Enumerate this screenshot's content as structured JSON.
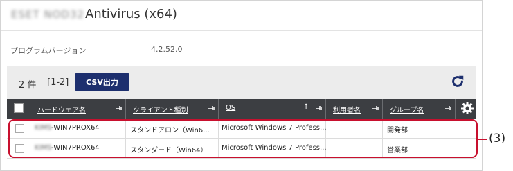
{
  "window": {
    "product_blurred": "ESET NOD32",
    "product_title": "Antivirus (x64)"
  },
  "info": {
    "version_label": "プログラムバージョン",
    "version_value": "4.2.52.0"
  },
  "toolbar": {
    "count": "2 件",
    "range": "[1-2]",
    "csv_label": "CSV出力",
    "refresh_icon": "refresh-icon"
  },
  "table": {
    "columns": [
      {
        "label": "ハードウェア名"
      },
      {
        "label": "クライアント種別"
      },
      {
        "label": "OS",
        "sort": "↑"
      },
      {
        "label": "利用者名"
      },
      {
        "label": "グループ名"
      }
    ],
    "rows": [
      {
        "hw_prefix": "KIMS",
        "hw_name": "-WIN7PROX64",
        "client": "スタンドアロン（Win6...",
        "os": "Microsoft Windows 7 Profess...",
        "user": "",
        "group": "開発部"
      },
      {
        "hw_prefix": "KIMS",
        "hw_name": "-WIN7PROX64",
        "client": "スタンダード（Win64）",
        "os": "Microsoft Windows 7 Profess...",
        "user": "",
        "group": "営業部"
      }
    ]
  },
  "annotation": {
    "callout": "(3)",
    "color": "#c8102e"
  },
  "colors": {
    "header_bg": "#3c3e42",
    "button_bg": "#1d2f6e",
    "refresh": "#1d2f6e"
  }
}
